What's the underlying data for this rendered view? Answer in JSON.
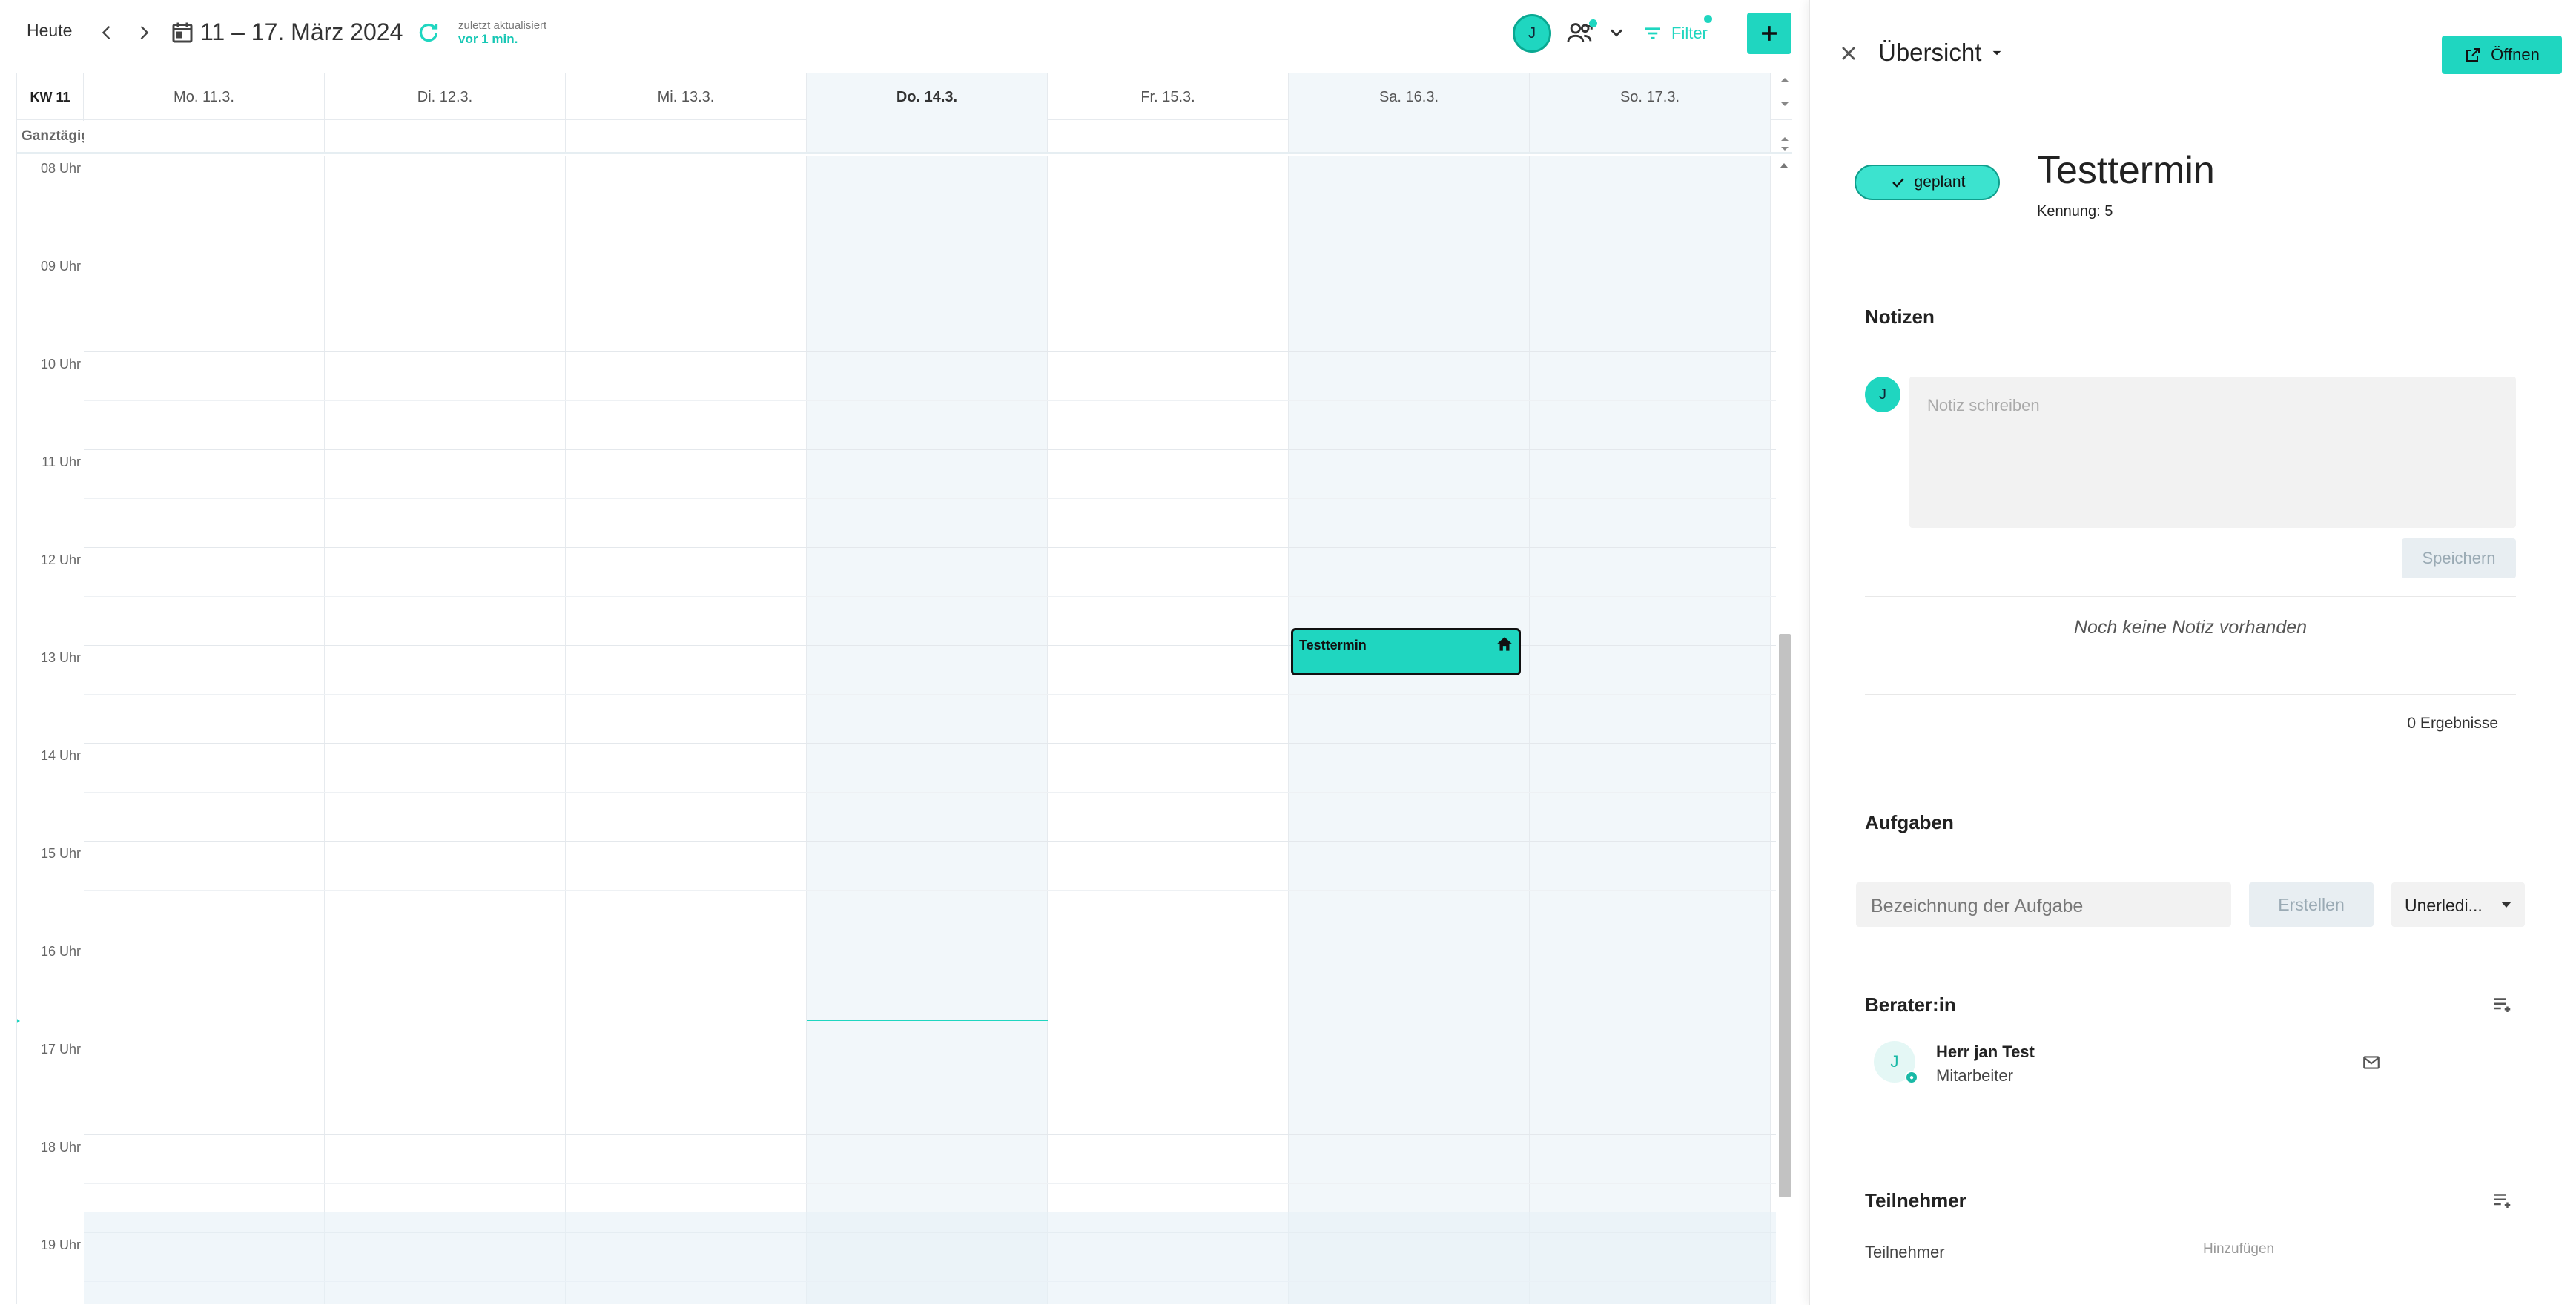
{
  "toolbar": {
    "today_label": "Heute",
    "date_range": "11 – 17. März 2024",
    "updated_label": "zuletzt aktualisiert",
    "updated_relative": "vor 1 min.",
    "user_initial": "J",
    "filter_label": "Filter"
  },
  "calendar": {
    "week_label": "KW 11",
    "allday_label": "Ganztägig",
    "days": [
      {
        "label": "Mo. 11.3."
      },
      {
        "label": "Di. 12.3."
      },
      {
        "label": "Mi. 13.3."
      },
      {
        "label": "Do. 14.3."
      },
      {
        "label": "Fr. 15.3."
      },
      {
        "label": "Sa. 16.3."
      },
      {
        "label": "So. 17.3."
      }
    ],
    "hours": [
      "08 Uhr",
      "09 Uhr",
      "10 Uhr",
      "11 Uhr",
      "12 Uhr",
      "13 Uhr",
      "14 Uhr",
      "15 Uhr",
      "16 Uhr",
      "17 Uhr",
      "18 Uhr",
      "19 Uhr"
    ],
    "event": {
      "title": "Testtermin",
      "icon": "home-icon"
    }
  },
  "panel": {
    "view_title": "Übersicht",
    "open_label": "Öffnen",
    "status": "geplant",
    "event_title": "Testtermin",
    "kennung": "Kennung: 5",
    "notes": {
      "title": "Notizen",
      "avatar_initial": "J",
      "placeholder": "Notiz schreiben",
      "save_label": "Speichern",
      "empty_text": "Noch keine Notiz vorhanden",
      "results": "0 Ergebnisse"
    },
    "tasks": {
      "title": "Aufgaben",
      "placeholder": "Bezeichnung der Aufgabe",
      "create_label": "Erstellen",
      "status_filter": "Unerledi..."
    },
    "advisor": {
      "title": "Berater:in",
      "initial": "J",
      "name": "Herr jan Test",
      "role": "Mitarbeiter"
    },
    "participants": {
      "title": "Teilnehmer",
      "label": "Teilnehmer",
      "add_label": "Hinzufügen"
    }
  },
  "colors": {
    "accent": "#1fd6c0",
    "today_bg": "#f2f7fa"
  }
}
